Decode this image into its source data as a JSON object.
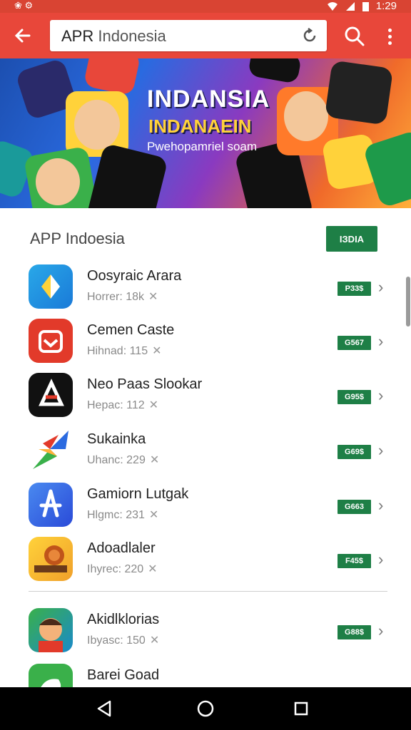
{
  "status_bar": {
    "left": "❀ ⚙",
    "time": "1:29"
  },
  "toolbar": {
    "search_value_bold": "APR",
    "search_value_rest": " Indonesia"
  },
  "banner": {
    "title": "INDANSIA",
    "subtitle": "INDANAEIN",
    "tagline": "Pwehopamriel soam"
  },
  "section": {
    "title": "APP Indoesia",
    "button_label": "IЗDIA"
  },
  "apps": [
    {
      "name": "Oosyraic Arara",
      "meta": "Horrer: 18k",
      "badge": "P33$"
    },
    {
      "name": "Cemen Caste",
      "meta": "Hihnad: 115",
      "badge": "G567"
    },
    {
      "name": "Neo Paas Slookar",
      "meta": "Hepac: 112",
      "badge": "G95$"
    },
    {
      "name": "Sukainka",
      "meta": "Uhanc: 229",
      "badge": "G69$"
    },
    {
      "name": "Gamiorn Lutgak",
      "meta": "Hlgmc: 231",
      "badge": "G663"
    },
    {
      "name": "Adoadlaler",
      "meta": "Ihyrec: 220",
      "badge": "F45$"
    },
    {
      "name": "Akidlklorias",
      "meta": "Ibyasc: 150",
      "badge": "G88$"
    },
    {
      "name": "Barei Goad",
      "meta": "",
      "badge": ""
    }
  ],
  "colors": {
    "toolbar": "#e8473a",
    "status_bar": "#d94433",
    "accent_green": "#1e7f46"
  }
}
